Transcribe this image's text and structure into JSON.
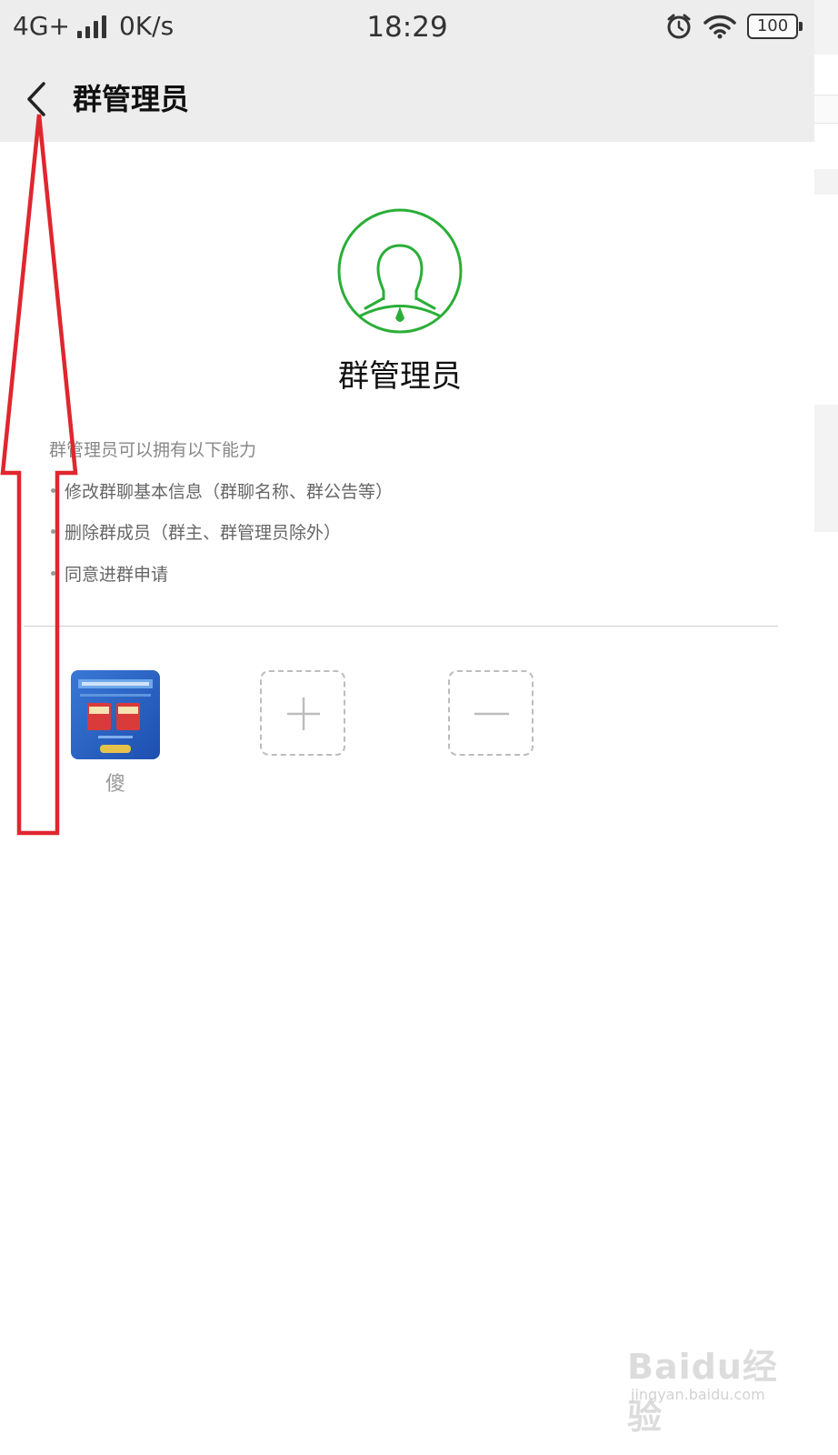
{
  "status_bar": {
    "network": "4G+",
    "speed": "0K/s",
    "time": "18:29",
    "battery": "100",
    "icons": [
      "signal-icon",
      "alarm-icon",
      "wifi-icon",
      "battery-icon"
    ]
  },
  "nav": {
    "back_icon": "chevron-left-icon",
    "title": "群管理员"
  },
  "hero": {
    "icon": "person-icon",
    "title": "群管理员",
    "accent_color": "#2aae37"
  },
  "permissions": {
    "heading": "群管理员可以拥有以下能力",
    "items": [
      "修改群聊基本信息（群聊名称、群公告等）",
      "删除群成员（群主、群管理员除外）",
      "同意进群申请"
    ]
  },
  "members": [
    {
      "name": "傻"
    }
  ],
  "actions": {
    "add_icon": "plus-icon",
    "remove_icon": "minus-icon"
  },
  "annotation": {
    "arrow_icon": "arrow-up-icon",
    "color": "#e0262e"
  },
  "watermark": {
    "logo": "Baidu经验",
    "url": "jingyan.baidu.com"
  }
}
